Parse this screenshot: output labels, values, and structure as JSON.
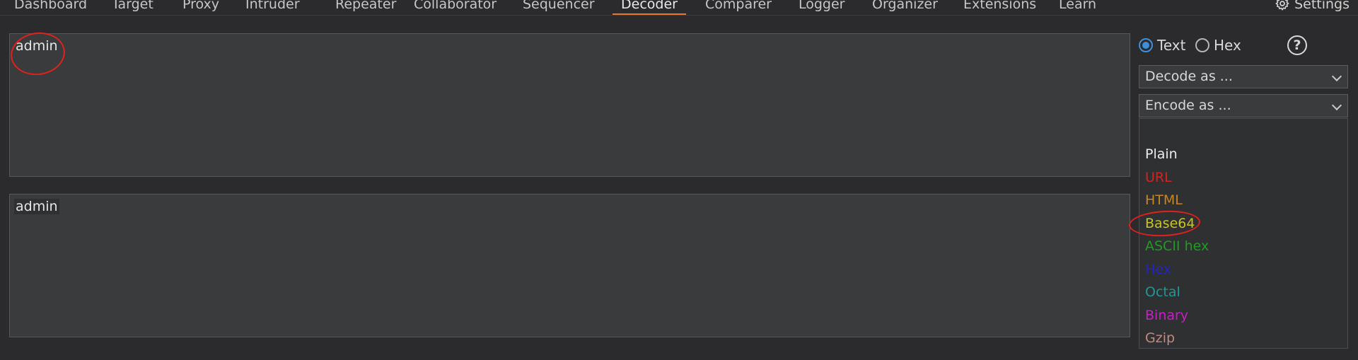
{
  "tabs": [
    "Dashboard",
    "Target",
    "Proxy",
    "Intruder",
    "Repeater",
    "Collaborator",
    "Sequencer",
    "Decoder",
    "Comparer",
    "Logger",
    "Organizer",
    "Extensions",
    "Learn"
  ],
  "active_tab": "Decoder",
  "settings_label": "Settings",
  "input_panel": {
    "text": "admin"
  },
  "output_panel": {
    "text": "admin"
  },
  "mode": {
    "text_label": "Text",
    "hex_label": "Hex",
    "selected": "Text"
  },
  "help_label": "?",
  "decode_dropdown": {
    "label": "Decode as ..."
  },
  "encode_dropdown": {
    "label": "Encode as ..."
  },
  "encode_options": [
    {
      "label": "Plain",
      "color": "#ececec"
    },
    {
      "label": "URL",
      "color": "#d42222"
    },
    {
      "label": "HTML",
      "color": "#c8861e"
    },
    {
      "label": "Base64",
      "color": "#c9c41f"
    },
    {
      "label": "ASCII hex",
      "color": "#239a23"
    },
    {
      "label": "Hex",
      "color": "#2323c8"
    },
    {
      "label": "Octal",
      "color": "#219696"
    },
    {
      "label": "Binary",
      "color": "#c81ec8"
    },
    {
      "label": "Gzip",
      "color": "#c08a80"
    }
  ],
  "icons": {
    "settings": "gear-icon",
    "help": "help-icon",
    "chevron": "chevron-down-icon"
  },
  "accent_color": "#e8772e"
}
